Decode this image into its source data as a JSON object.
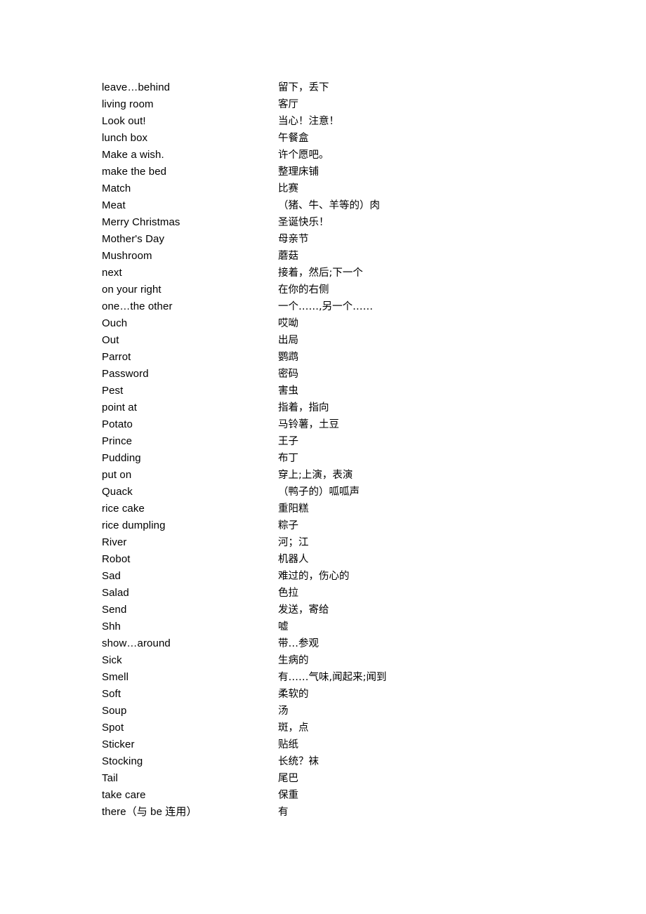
{
  "document": {
    "type": "bilingual-glossary",
    "columns": {
      "term_header": "",
      "definition_header": ""
    },
    "entries": [
      {
        "term": "leave…behind",
        "definition": "留下，丢下"
      },
      {
        "term": "living room",
        "definition": "客厅"
      },
      {
        "term": "Look out!",
        "definition": "当心！注意！"
      },
      {
        "term": "lunch box",
        "definition": "午餐盒"
      },
      {
        "term": "Make a wish.",
        "definition": "许个愿吧。"
      },
      {
        "term": "make the bed",
        "definition": "整理床铺"
      },
      {
        "term": "Match",
        "definition": "比赛"
      },
      {
        "term": "Meat",
        "definition": "（猪、牛、羊等的）肉"
      },
      {
        "term": "Merry Christmas",
        "definition": "圣诞快乐！"
      },
      {
        "term": "Mother's Day",
        "definition": "母亲节"
      },
      {
        "term": "Mushroom",
        "definition": "蘑菇"
      },
      {
        "term": "next",
        "definition": "接着，然后;下一个"
      },
      {
        "term": "on your right",
        "definition": "在你的右侧"
      },
      {
        "term": "one…the other",
        "definition": "一个……,另一个……"
      },
      {
        "term": "Ouch",
        "definition": "哎呦"
      },
      {
        "term": "Out",
        "definition": "出局"
      },
      {
        "term": "Parrot",
        "definition": "鹦鹉"
      },
      {
        "term": "Password",
        "definition": "密码"
      },
      {
        "term": "Pest",
        "definition": "害虫"
      },
      {
        "term": "point at",
        "definition": "指着，指向"
      },
      {
        "term": "Potato",
        "definition": "马铃薯，土豆"
      },
      {
        "term": "Prince",
        "definition": "王子"
      },
      {
        "term": "Pudding",
        "definition": "布丁"
      },
      {
        "term": "put on",
        "definition": "穿上;上演，表演"
      },
      {
        "term": "Quack",
        "definition": "（鸭子的）呱呱声"
      },
      {
        "term": "rice cake",
        "definition": "重阳糕"
      },
      {
        "term": "rice dumpling",
        "definition": "粽子"
      },
      {
        "term": "River",
        "definition": "河；江"
      },
      {
        "term": "Robot",
        "definition": "机器人"
      },
      {
        "term": "Sad",
        "definition": "难过的，伤心的"
      },
      {
        "term": "Salad",
        "definition": "色拉"
      },
      {
        "term": "Send",
        "definition": "发送，寄给"
      },
      {
        "term": "Shh",
        "definition": "嘘"
      },
      {
        "term": "show…around",
        "definition": "带…参观"
      },
      {
        "term": "Sick",
        "definition": "生病的"
      },
      {
        "term": "Smell",
        "definition": "有……气味,闻起来;闻到"
      },
      {
        "term": "Soft",
        "definition": "柔软的"
      },
      {
        "term": "Soup",
        "definition": "汤"
      },
      {
        "term": "Spot",
        "definition": "斑，点"
      },
      {
        "term": "Sticker",
        "definition": "贴纸"
      },
      {
        "term": "Stocking",
        "definition": "长统？袜"
      },
      {
        "term": "Tail",
        "definition": "尾巴"
      },
      {
        "term": "take care",
        "definition": "保重"
      },
      {
        "term": "there（与 be 连用）",
        "definition": "有"
      }
    ]
  }
}
